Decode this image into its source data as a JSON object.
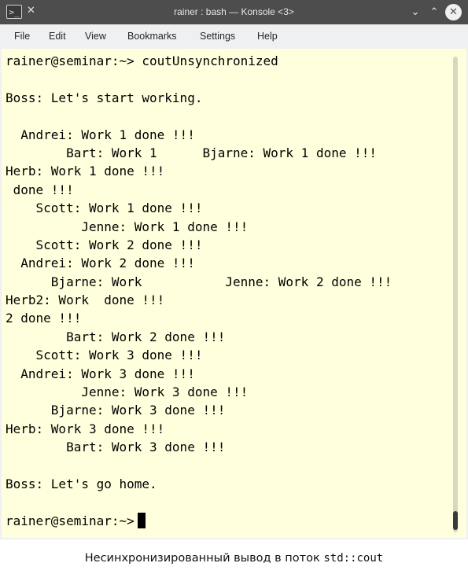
{
  "window": {
    "title": "rainer : bash — Konsole <3>",
    "titlebar_color": "#4d4d4d",
    "icons": [
      "terminal-app-icon",
      "pin-icon",
      "chevron-down-icon",
      "chevron-up-icon",
      "close-icon"
    ]
  },
  "menubar": {
    "items": [
      "File",
      "Edit",
      "View",
      "Bookmarks",
      "Settings",
      "Help"
    ]
  },
  "terminal": {
    "background_color": "#ffffdd",
    "lines": [
      "rainer@seminar:~> coutUnsynchronized",
      "",
      "Boss: Let's start working.",
      "",
      "  Andrei: Work 1 done !!!",
      "        Bart: Work 1      Bjarne: Work 1 done !!!",
      "Herb: Work 1 done !!!",
      " done !!!",
      "    Scott: Work 1 done !!!",
      "          Jenne: Work 1 done !!!",
      "    Scott: Work 2 done !!!",
      "  Andrei: Work 2 done !!!",
      "      Bjarne: Work           Jenne: Work 2 done !!!",
      "Herb2: Work  done !!!",
      "2 done !!!",
      "        Bart: Work 2 done !!!",
      "    Scott: Work 3 done !!!",
      "  Andrei: Work 3 done !!!",
      "          Jenne: Work 3 done !!!",
      "      Bjarne: Work 3 done !!!",
      "Herb: Work 3 done !!!",
      "        Bart: Work 3 done !!!",
      "",
      "Boss: Let's go home.",
      ""
    ],
    "prompt": "rainer@seminar:~>"
  },
  "caption": {
    "text": "Несинхронизированный вывод в поток ",
    "code": "std::cout"
  }
}
